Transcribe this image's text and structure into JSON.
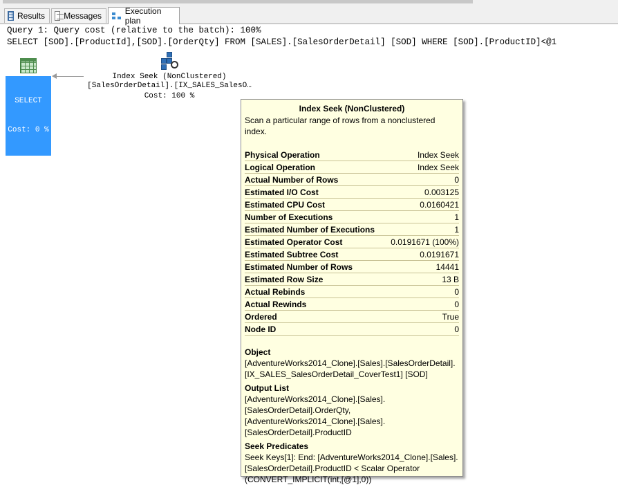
{
  "tabs": [
    {
      "label": "Results",
      "icon": "grid-icon"
    },
    {
      "label": "Messages",
      "icon": "messages-icon"
    },
    {
      "label": "Execution plan",
      "icon": "execution-plan-icon"
    }
  ],
  "query": {
    "cost_line": "Query 1: Query cost (relative to the batch): 100%",
    "sql_line": "SELECT [SOD].[ProductId],[SOD].[OrderQty] FROM [SALES].[SalesOrderDetail] [SOD] WHERE [SOD].[ProductID]<@1"
  },
  "plan": {
    "select_node": {
      "label": "SELECT",
      "cost": "Cost: 0 %"
    },
    "seek_node": {
      "name": "Index Seek (NonClustered)",
      "object": "[SalesOrderDetail].[IX_SALES_SalesO…",
      "cost": "Cost: 100 %"
    }
  },
  "tooltip": {
    "title": "Index Seek (NonClustered)",
    "description": "Scan a particular range of rows from a nonclustered index.",
    "properties": [
      {
        "name": "Physical Operation",
        "value": "Index Seek"
      },
      {
        "name": "Logical Operation",
        "value": "Index Seek"
      },
      {
        "name": "Actual Number of Rows",
        "value": "0"
      },
      {
        "name": "Estimated I/O Cost",
        "value": "0.003125"
      },
      {
        "name": "Estimated CPU Cost",
        "value": "0.0160421"
      },
      {
        "name": "Number of Executions",
        "value": "1"
      },
      {
        "name": "Estimated Number of Executions",
        "value": "1"
      },
      {
        "name": "Estimated Operator Cost",
        "value": "0.0191671 (100%)"
      },
      {
        "name": "Estimated Subtree Cost",
        "value": "0.0191671"
      },
      {
        "name": "Estimated Number of Rows",
        "value": "14441"
      },
      {
        "name": "Estimated Row Size",
        "value": "13 B"
      },
      {
        "name": "Actual Rebinds",
        "value": "0"
      },
      {
        "name": "Actual Rewinds",
        "value": "0"
      },
      {
        "name": "Ordered",
        "value": "True"
      },
      {
        "name": "Node ID",
        "value": "0"
      }
    ],
    "object_heading": "Object",
    "object_lines": [
      "[AdventureWorks2014_Clone].[Sales].[SalesOrderDetail].",
      "[IX_SALES_SalesOrderDetail_CoverTest1] [SOD]"
    ],
    "output_heading": "Output List",
    "output_lines": [
      "[AdventureWorks2014_Clone].[Sales].",
      "[SalesOrderDetail].OrderQty,",
      "[AdventureWorks2014_Clone].[Sales].",
      "[SalesOrderDetail].ProductID"
    ],
    "seek_heading": "Seek Predicates",
    "seek_lines": [
      "Seek Keys[1]: End: [AdventureWorks2014_Clone].[Sales].",
      "[SalesOrderDetail].ProductID < Scalar Operator",
      "(CONVERT_IMPLICIT(int,[@1],0))"
    ]
  },
  "colors": {
    "selection": "#3399ff",
    "tooltip_bg": "#ffffe1",
    "tooltip_rule": "#c8c295"
  }
}
